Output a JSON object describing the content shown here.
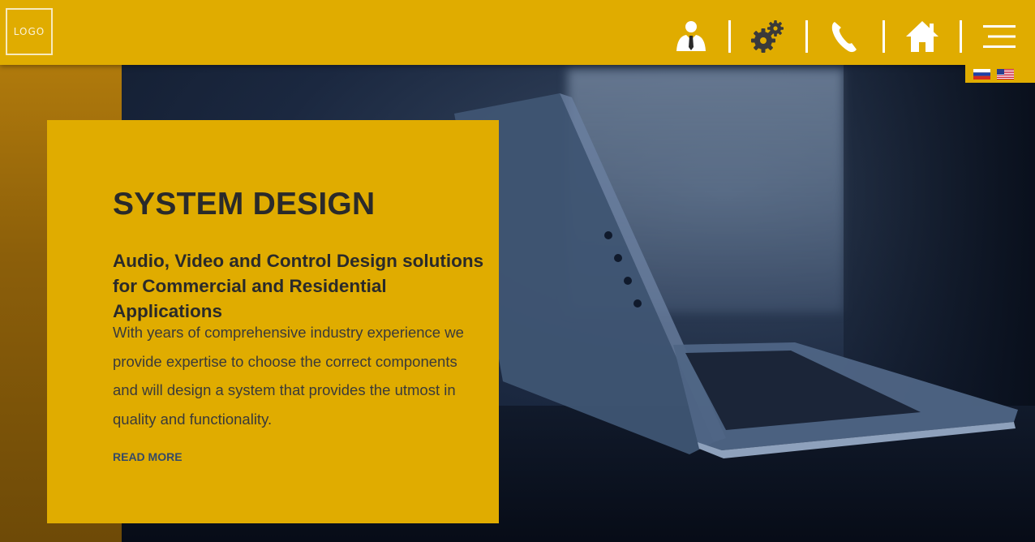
{
  "header": {
    "logo_text": "LOGO",
    "nav": [
      {
        "icon": "user-icon"
      },
      {
        "icon": "gears-icon"
      },
      {
        "icon": "phone-icon"
      },
      {
        "icon": "home-icon"
      },
      {
        "icon": "menu-icon"
      }
    ],
    "languages": [
      {
        "code": "ru",
        "icon": "russia-flag-icon"
      },
      {
        "code": "en",
        "icon": "us-flag-icon"
      }
    ]
  },
  "hero": {
    "title": "SYSTEM DESIGN",
    "subtitle": "Audio, Video and Control Design solutions for Commercial and Residential Applications",
    "body": "With years of comprehensive industry experience we provide expertise to choose the correct components and will design a system that provides the utmost in quality and functionality.",
    "read_more_label": "READ MORE"
  },
  "colors": {
    "accent": "#e0ac00",
    "text_dark": "#2a2a2a",
    "link": "#354a66",
    "icon_white": "#ffffff"
  }
}
